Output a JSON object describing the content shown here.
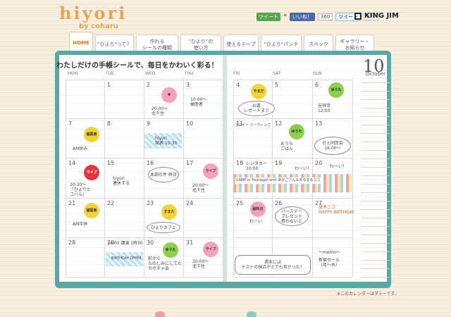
{
  "header": {
    "logo_main": "hiyori",
    "logo_sub": "by coharu",
    "social": {
      "green_label": "ツイート",
      "like_label": "いいね！",
      "like_count": "360",
      "tweet_label": "ツイート",
      "tweet_count": "677"
    },
    "brand": "KING JIM"
  },
  "nav": [
    {
      "label": "HOME"
    },
    {
      "label": "\"ひより\"って？"
    },
    {
      "label": "作れる\nシールの種類"
    },
    {
      "label": "\"ひより\"の\n使い方"
    },
    {
      "label": "使えるテープ"
    },
    {
      "label": "\"ひより\"パンチ"
    },
    {
      "label": "スペック"
    },
    {
      "label": "ギャラリー・\nお知らせ"
    }
  ],
  "calendar": {
    "heading": "わたしだけの手帳シールで、毎日をかわいく彩る！",
    "month_number": "10",
    "month_name": "October",
    "weekdays": [
      "MON",
      "TUE",
      "WED",
      "THU",
      "FRI",
      "SAT",
      "SUN"
    ],
    "days": [
      "",
      "1",
      "2",
      "3",
      "4",
      "5",
      "6",
      "7",
      "8",
      "9",
      "10",
      "11",
      "12",
      "13",
      "14",
      "15",
      "16",
      "17",
      "18",
      "19",
      "20",
      "21",
      "22",
      "23",
      "24",
      "25",
      "26",
      "27",
      "28",
      "29",
      "30",
      "31"
    ],
    "notes": {
      "d2": "20:00〜\n北千住",
      "d3": "10:00〜\n歯医者",
      "d4_stamp": "やまだ",
      "d4_bubble": "お誕\nレポートまで",
      "d5": "",
      "d6": "吉祥寺\n12:00",
      "d6_stamp": "ゆうた",
      "d7_stamp": "歯医者",
      "d7": "AM休み",
      "d9": "hiyori\n発表 10:30",
      "d11": "リエイト\nミーティング",
      "d12_stamp": "ゆうた",
      "d12": "おうち\nごはん",
      "d13": "ゼミ同窓会\n16:00〜",
      "d14_stamp": "ライブ",
      "d14": "20:30〜\n「ひよりと\nコハル」",
      "d15": "hiyori\n連休する",
      "d16": "本部の件\n終日",
      "d17_stamp": "ライブ",
      "d17": "20:00〜\n北千住",
      "d18": "レンタカー\n10:00",
      "d18_tape": "CAMP in Tsumagoi with あかごさん＆まるまるココ",
      "d19": "わーい！",
      "d20": "わーい！",
      "d21_stamp": "歯医者",
      "d21": "AM半休",
      "d23_stamp": "すまた",
      "d23": "ひよりカフェ",
      "d24_stamp": "給料日",
      "d24": "わーい",
      "d25": "バースデー\nプレゼント\n買わないと",
      "d26": "夏木ニコ\nHAPPY BIRTHDAY",
      "d29": "14:00 講演 1時30",
      "d29_tape": "BIRTHDAY OFFER",
      "d30": "前から\nたのしみにしてた\nカボチャ会",
      "d30_stamp": "ゆうた",
      "d31_stamp": "ライブ",
      "d31": "20:00〜\n北千住",
      "d1_fri_note": "週末には\nテストの採点がとても良かった！",
      "memo_label": "〜memo〜",
      "memo": "新宿セール\n（月〜水）"
    },
    "footnote": "※このカレンダーはダミーです。"
  },
  "colors": {
    "accent": "#e07a2b",
    "binder": "#5aa7a5",
    "background": "#f6efe0"
  }
}
